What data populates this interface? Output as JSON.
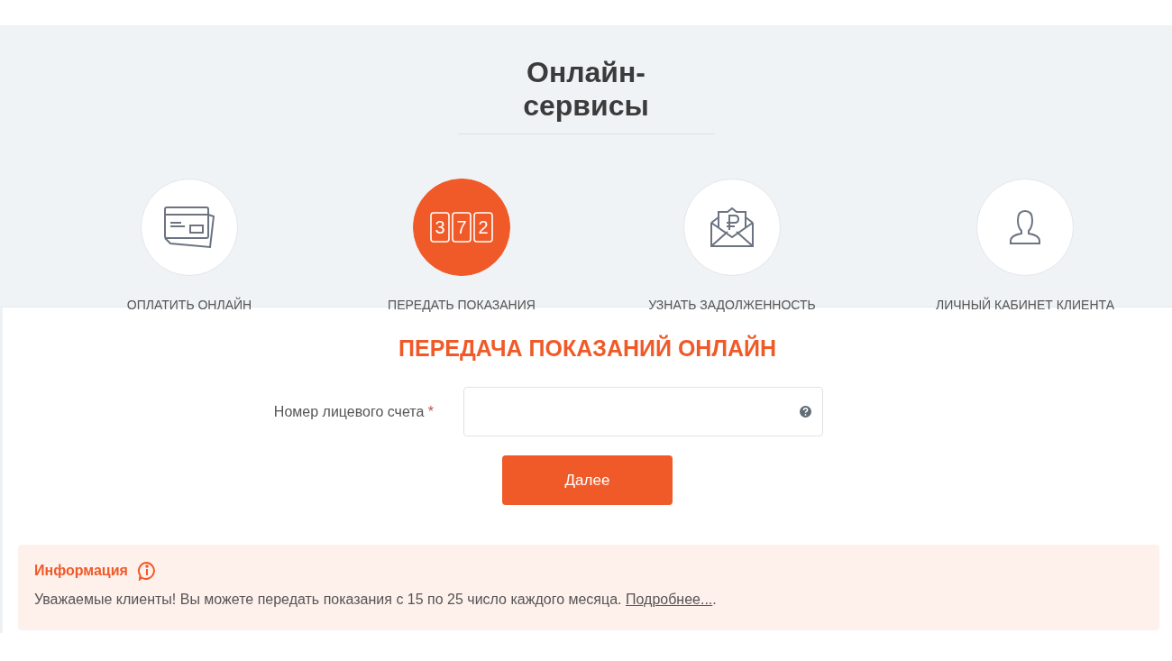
{
  "section_title": "Онлайн-сервисы",
  "services": [
    {
      "kind": "card",
      "label": "ОПЛАТИТЬ ОНЛАЙН",
      "selected": false
    },
    {
      "kind": "meter",
      "label": "ПЕРЕДАТЬ ПОКАЗАНИЯ",
      "selected": true,
      "digits": [
        "3",
        "7",
        "2"
      ]
    },
    {
      "kind": "envelope",
      "label": "УЗНАТЬ ЗАДОЛЖЕННОСТЬ",
      "selected": false
    },
    {
      "kind": "user",
      "label": "ЛИЧНЫЙ КАБИНЕТ КЛИЕНТА",
      "selected": false
    }
  ],
  "form": {
    "title": "ПЕРЕДАЧА ПОКАЗАНИЙ ОНЛАЙН",
    "field_label": "Номер лицевого счета",
    "required_mark": "*",
    "submit": "Далее"
  },
  "info": {
    "title": "Информация",
    "text": "Уважаемые клиенты! Вы можете передать показания с 15 по 25 число каждого месяца.",
    "link": "Подробнее...",
    "after_link": "."
  }
}
